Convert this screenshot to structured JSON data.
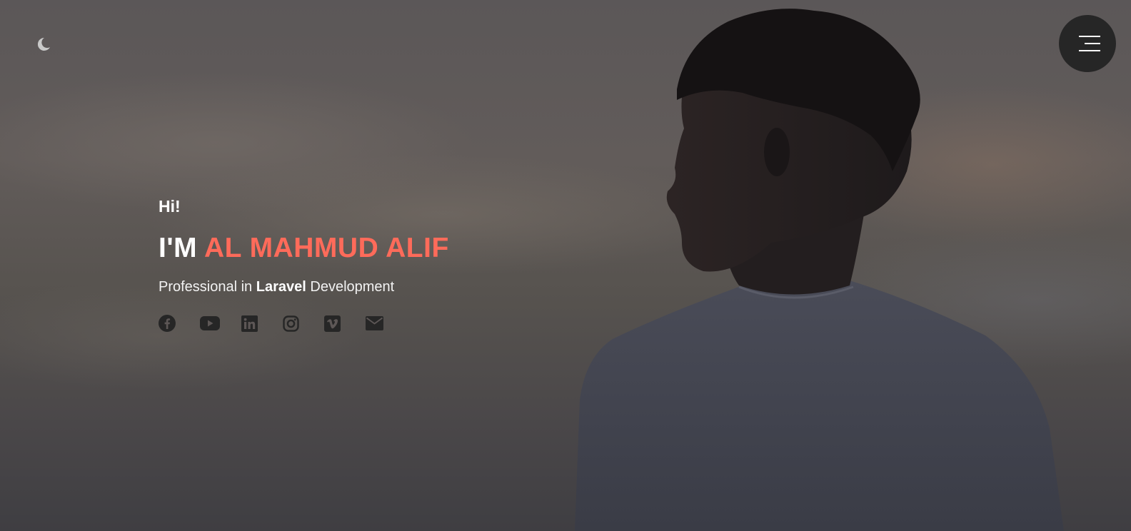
{
  "header": {
    "theme_toggle_icon": "moon-icon",
    "menu_icon": "hamburger-menu-icon"
  },
  "intro": {
    "greeting": "Hi!",
    "headline_prefix": "I'M",
    "name": "AL MAHMUD ALIF",
    "tagline_before": "Professional in",
    "tagline_highlight": "Laravel",
    "tagline_after": "Development"
  },
  "socials": [
    {
      "icon": "facebook-icon"
    },
    {
      "icon": "youtube-icon"
    },
    {
      "icon": "linkedin-icon"
    },
    {
      "icon": "instagram-icon"
    },
    {
      "icon": "vimeo-icon"
    },
    {
      "icon": "envelope-icon"
    }
  ],
  "colors": {
    "accent": "#ff6b5a",
    "menu_bg": "#262626",
    "social_icon": "#262626",
    "text": "#ffffff"
  }
}
